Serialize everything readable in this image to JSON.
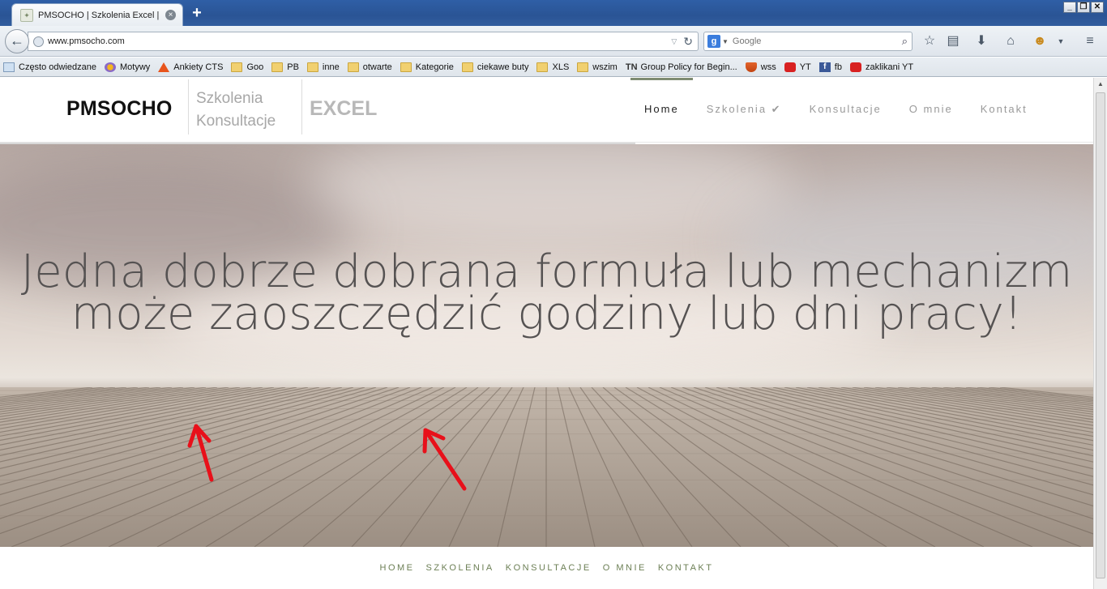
{
  "browser": {
    "tab_title": "PMSOCHO | Szkolenia Excel | ...",
    "new_tab_symbol": "+",
    "window_controls": [
      "_",
      "❐",
      "✕"
    ],
    "url": "www.pmsocho.com",
    "search_placeholder": "Google",
    "bookmarks": [
      {
        "label": "Często odwiedzane",
        "icon": "page-icon"
      },
      {
        "label": "Motywy",
        "icon": "theme-icon"
      },
      {
        "label": "Ankiety CTS",
        "icon": "survey-icon"
      },
      {
        "label": "Goo",
        "icon": "folder-icon"
      },
      {
        "label": "PB",
        "icon": "folder-icon"
      },
      {
        "label": "inne",
        "icon": "folder-icon"
      },
      {
        "label": "otwarte",
        "icon": "folder-icon"
      },
      {
        "label": "Kategorie",
        "icon": "folder-icon"
      },
      {
        "label": "ciekawe buty",
        "icon": "folder-icon"
      },
      {
        "label": "XLS",
        "icon": "folder-icon"
      },
      {
        "label": "wszim",
        "icon": "folder-icon"
      },
      {
        "label": "Group Policy for Begin...",
        "icon": "tn-icon",
        "prefix": "TN"
      },
      {
        "label": "wss",
        "icon": "shield-icon"
      },
      {
        "label": "YT",
        "icon": "youtube-icon"
      },
      {
        "label": "fb",
        "icon": "facebook-icon"
      },
      {
        "label": "zaklikani YT",
        "icon": "youtube-icon"
      }
    ]
  },
  "site": {
    "logo_main": "PMSOCHO",
    "logo_sub_line1": "Szkolenia",
    "logo_sub_line2": "Konsultacje",
    "logo_excel": "EXCEL",
    "nav": [
      {
        "label": "Home",
        "active": true
      },
      {
        "label": "Szkolenia ✔",
        "active": false
      },
      {
        "label": "Konsultacje",
        "active": false
      },
      {
        "label": "O mnie",
        "active": false
      },
      {
        "label": "Kontakt",
        "active": false
      }
    ],
    "hero_line1": "Jedna dobrze dobrana formuła lub mechanizm",
    "hero_line2": "może zaoszczędzić godziny lub dni pracy!",
    "footer_nav": [
      "HOME",
      "SZKOLENIA",
      "KONSULTACJE",
      "O MNIE",
      "KONTAKT"
    ]
  },
  "colors": {
    "accent_green": "#7f8c72",
    "footer_green": "#6c7f55",
    "annotation_arrow": "#e8101a"
  }
}
